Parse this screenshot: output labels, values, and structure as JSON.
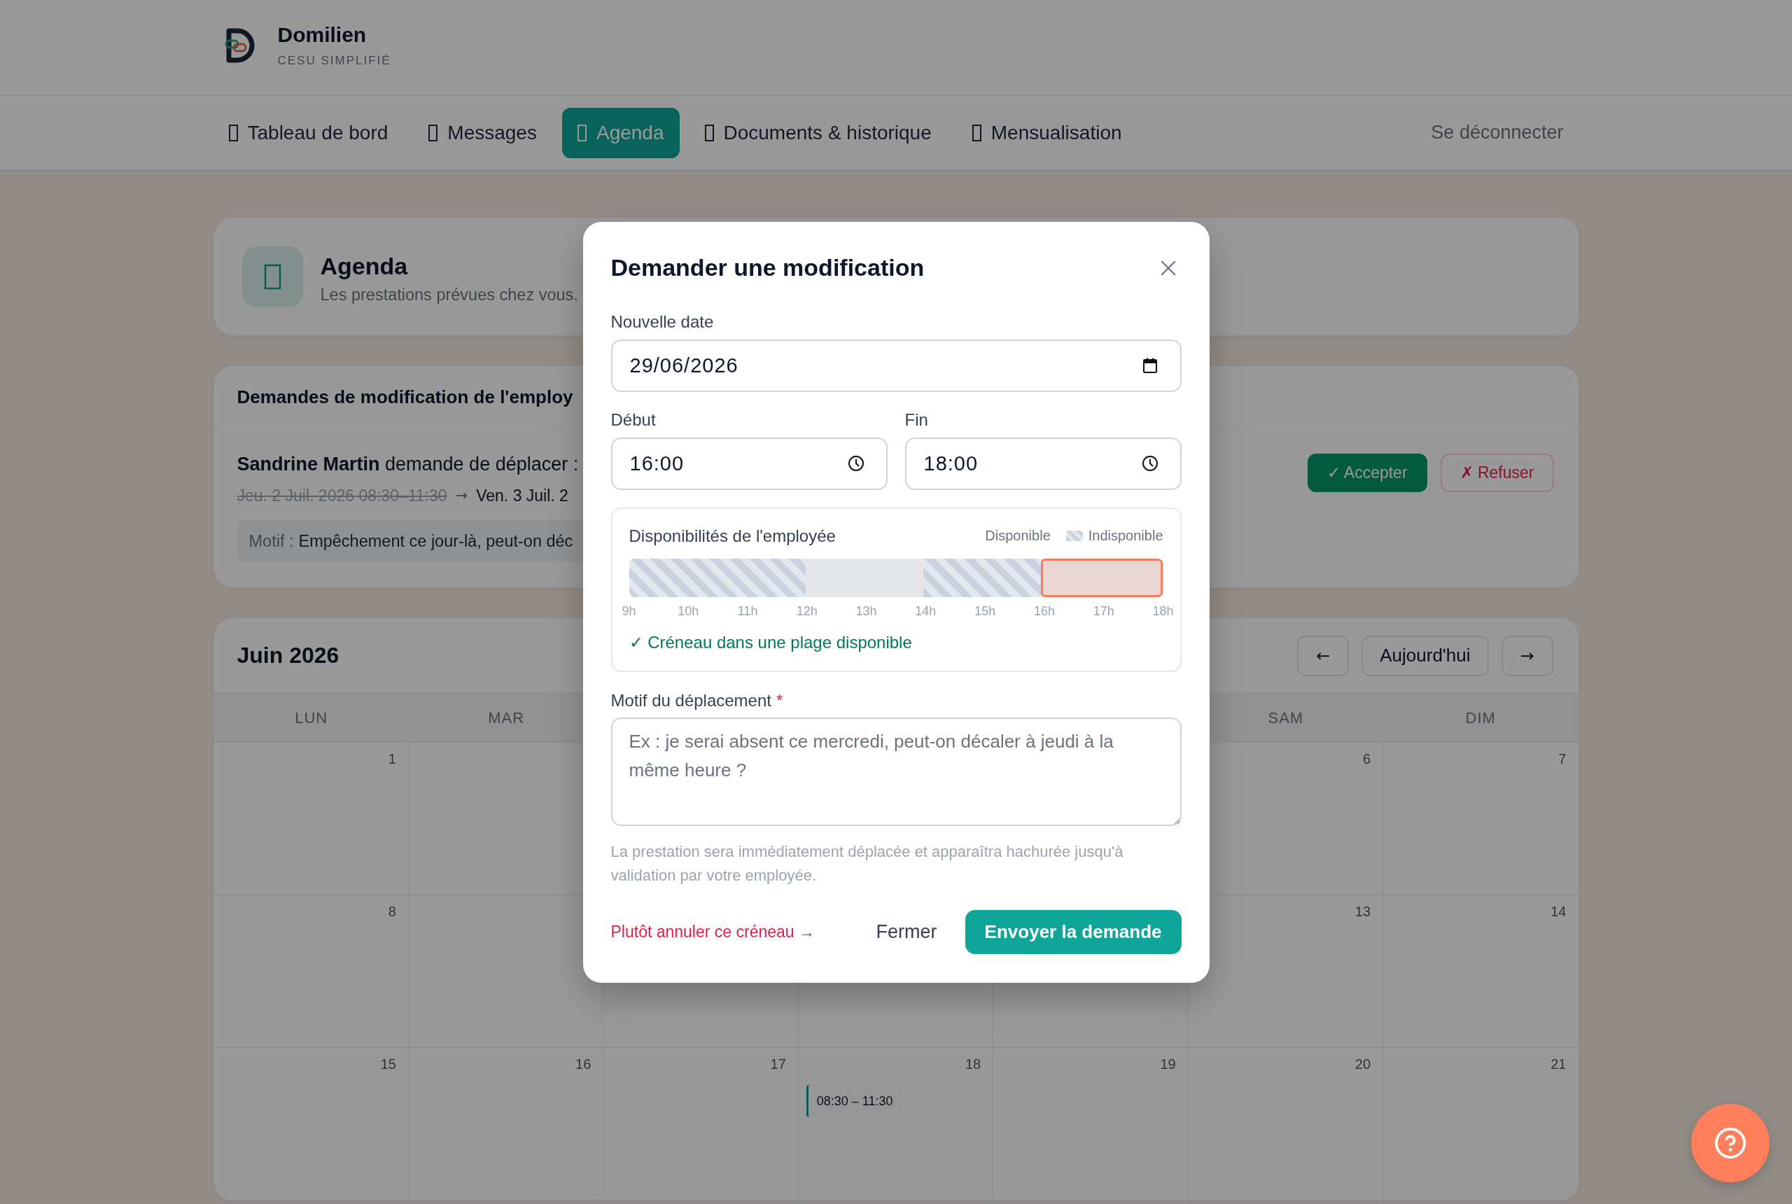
{
  "brand": {
    "name": "Domilien",
    "tagline": "CESU SIMPLIFIÉ"
  },
  "nav": {
    "items": [
      {
        "label": "Tableau de bord",
        "selected": false
      },
      {
        "label": "Messages",
        "selected": false
      },
      {
        "label": "Agenda",
        "selected": true
      },
      {
        "label": "Documents & historique",
        "selected": false
      },
      {
        "label": "Mensualisation",
        "selected": false
      }
    ],
    "logout": "Se déconnecter"
  },
  "page_header": {
    "title": "Agenda",
    "subtitle": "Les prestations prévues chez vous."
  },
  "change_requests": {
    "title": "Demandes de modification de l'employ",
    "items": [
      {
        "summary": "**Sandrine Martin** demande de déplacer :",
        "old_slot": "Jeu. 2 Juil. 2026 08:30–11:30",
        "arrow": "→",
        "new_slot": "Ven. 3 Juil. 2",
        "reason_label": "Motif :",
        "reason": "Empêchement ce jour-là, peut-on déc",
        "accept_button": "✓ Accepter",
        "refuse_button": "✗ Refuser"
      }
    ]
  },
  "calendar": {
    "title": "Juin 2026",
    "prev_button": "←",
    "today_button": "Aujourd'hui",
    "next_button": "→",
    "weekdays": [
      {
        "kind": "label",
        "text": "LUN"
      },
      {
        "kind": "label",
        "text": "MAR"
      },
      {
        "kind": "hidden"
      },
      {
        "kind": "hidden"
      },
      {
        "kind": "hidden"
      },
      {
        "kind": "label",
        "text": "SAM"
      },
      {
        "kind": "label",
        "text": "DIM"
      }
    ],
    "weeks": [
      {
        "days": [
          {
            "kind": "day",
            "number": "1"
          },
          {
            "kind": "hidden"
          },
          {
            "kind": "hidden"
          },
          {
            "kind": "hidden"
          },
          {
            "kind": "hidden"
          },
          {
            "kind": "day",
            "number": "6"
          },
          {
            "kind": "day",
            "number": "7"
          }
        ]
      },
      {
        "days": [
          {
            "kind": "day",
            "number": "8"
          },
          {
            "kind": "hidden"
          },
          {
            "kind": "hidden"
          },
          {
            "kind": "hidden"
          },
          {
            "kind": "hidden"
          },
          {
            "kind": "day",
            "number": "13"
          },
          {
            "kind": "day",
            "number": "14"
          }
        ]
      },
      {
        "days": [
          {
            "kind": "day",
            "number": "15"
          },
          {
            "kind": "day",
            "number": "16"
          },
          {
            "kind": "day",
            "number": "17"
          },
          {
            "kind": "day",
            "number": "18",
            "events": [
              {
                "time": "08:30 – 11:30"
              }
            ]
          },
          {
            "kind": "day",
            "number": "19"
          },
          {
            "kind": "day",
            "number": "20"
          },
          {
            "kind": "day",
            "number": "21"
          }
        ]
      }
    ]
  },
  "modal": {
    "title": "Demander une modification",
    "date_field": {
      "label": "Nouvelle date",
      "value": "29/06/2026"
    },
    "time_fields": [
      {
        "label": "Début",
        "value": "16:00"
      },
      {
        "label": "Fin",
        "value": "18:00"
      }
    ],
    "availability": {
      "title": "Disponibilités de l'employée",
      "legend": [
        {
          "label": "Disponible",
          "kind": "available"
        },
        {
          "label": "Indisponible",
          "kind": "unavailable"
        }
      ],
      "hour_slots": [
        {
          "kind": "unavailable"
        },
        {
          "kind": "unavailable"
        },
        {
          "kind": "unavailable"
        },
        {
          "kind": "available"
        },
        {
          "kind": "available"
        },
        {
          "kind": "unavailable"
        },
        {
          "kind": "unavailable"
        },
        {
          "kind": "selected"
        },
        {
          "kind": "selected"
        }
      ],
      "hour_labels": [
        "9h",
        "10h",
        "11h",
        "12h",
        "13h",
        "14h",
        "15h",
        "16h",
        "17h",
        "18h"
      ],
      "status": "✓ Créneau dans une plage disponible"
    },
    "reason_field": {
      "label": "Motif du déplacement",
      "required_mark": "*",
      "placeholder": "Ex : je serai absent ce mercredi, peut-on décaler à jeudi à la même heure ?"
    },
    "note": "La prestation sera immédiatement déplacée et apparaîtra hachurée jusqu'à validation par votre employée.",
    "cancel_link": "Plutôt annuler ce créneau →",
    "close_button": "Fermer",
    "submit_button": "Envoyer la demande"
  }
}
